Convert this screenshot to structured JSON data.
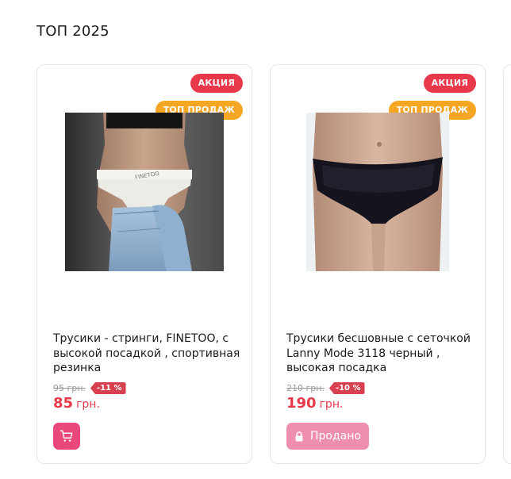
{
  "section": {
    "title": "ТОП 2025"
  },
  "products": [
    {
      "badges": {
        "sale": "АКЦИЯ",
        "top": "ТОП ПРОДАЖ"
      },
      "title": "Трусики - стринги, FINETOO, с высокой посадкой , спортивная резинка",
      "old_price": "95 грн.",
      "discount": "-11 %",
      "price": "85",
      "currency": "грн.",
      "action": {
        "type": "cart",
        "icon": "cart-icon"
      },
      "image": {
        "subject": "white sport thong with FINETOO waistband, jeans",
        "logo_text": "FINETOO"
      }
    },
    {
      "badges": {
        "sale": "АКЦИЯ",
        "top": "ТОП ПРОДАЖ"
      },
      "title": "Трусики бесшовные с сеточкой Lanny Mode 3118 черный , высокая посадка",
      "old_price": "210 грн.",
      "discount": "-10 %",
      "price": "190",
      "currency": "грн.",
      "action": {
        "type": "sold",
        "label": "Продано",
        "icon": "lock-icon"
      }
    }
  ],
  "colors": {
    "sale_badge": "#e8394a",
    "top_badge": "#f5a623",
    "price": "#e8394a",
    "discount": "#d6404f",
    "cart_button": "#e8497a",
    "sold_button": "#ef8eae"
  }
}
